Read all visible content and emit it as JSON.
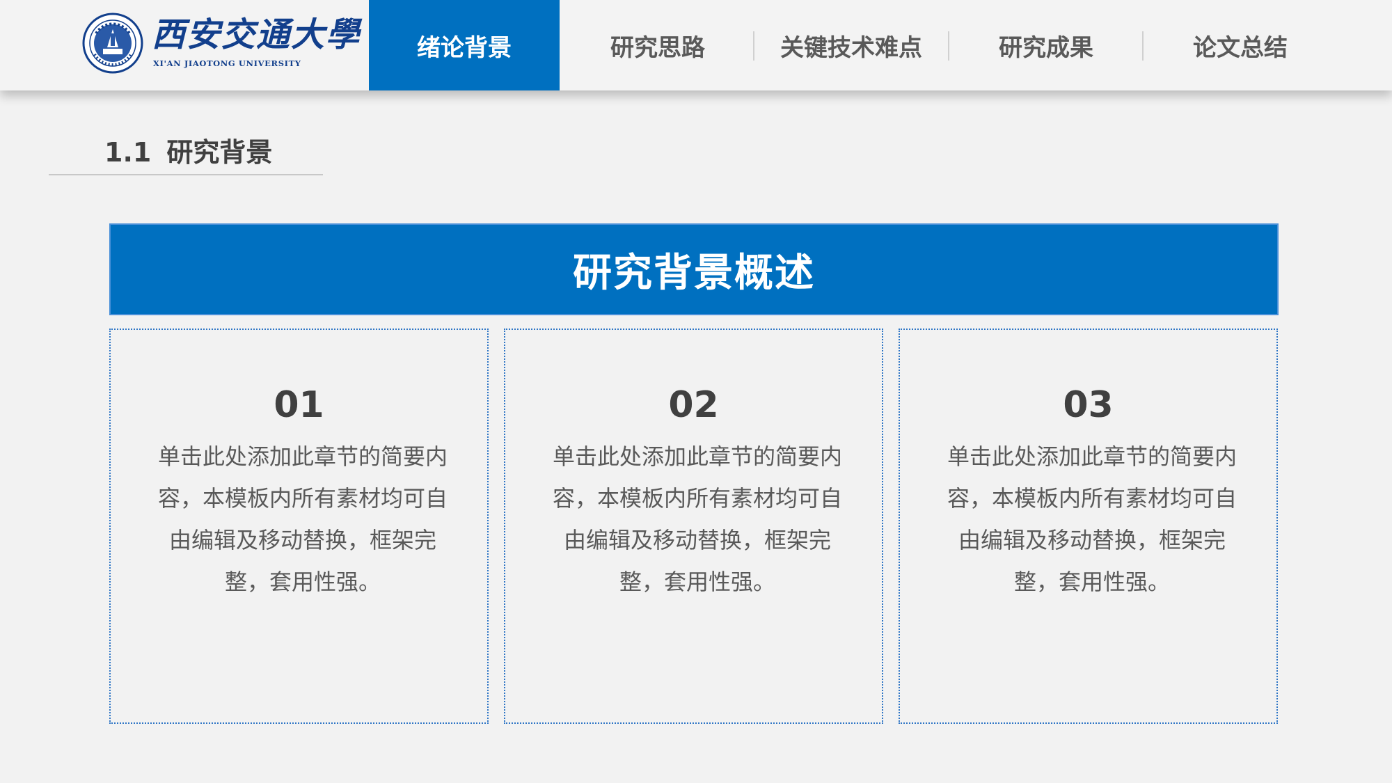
{
  "header": {
    "logo_cn": "西安交通大學",
    "logo_en": "XI'AN JIAOTONG UNIVERSITY",
    "tabs": [
      {
        "label": "绪论背景",
        "active": true
      },
      {
        "label": "研究思路",
        "active": false
      },
      {
        "label": "关键技术难点",
        "active": false
      },
      {
        "label": "研究成果",
        "active": false
      },
      {
        "label": "论文总结",
        "active": false
      }
    ]
  },
  "section": {
    "number": "1.1",
    "title": "研究背景"
  },
  "banner": {
    "title": "研究背景概述"
  },
  "cards": [
    {
      "number": "01",
      "text": "单击此处添加此章节的简要内容，本模板内所有素材均可自由编辑及移动替换，框架完整，套用性强。"
    },
    {
      "number": "02",
      "text": "单击此处添加此章节的简要内容，本模板内所有素材均可自由编辑及移动替换，框架完整，套用性强。"
    },
    {
      "number": "03",
      "text": "单击此处添加此章节的简要内容，本模板内所有素材均可自由编辑及移动替换，框架完整，套用性强。"
    }
  ],
  "colors": {
    "accent": "#0070c0",
    "background": "#f2f2f2",
    "text_dark": "#404040",
    "text_body": "#595959",
    "logo_blue": "#123f8c"
  }
}
